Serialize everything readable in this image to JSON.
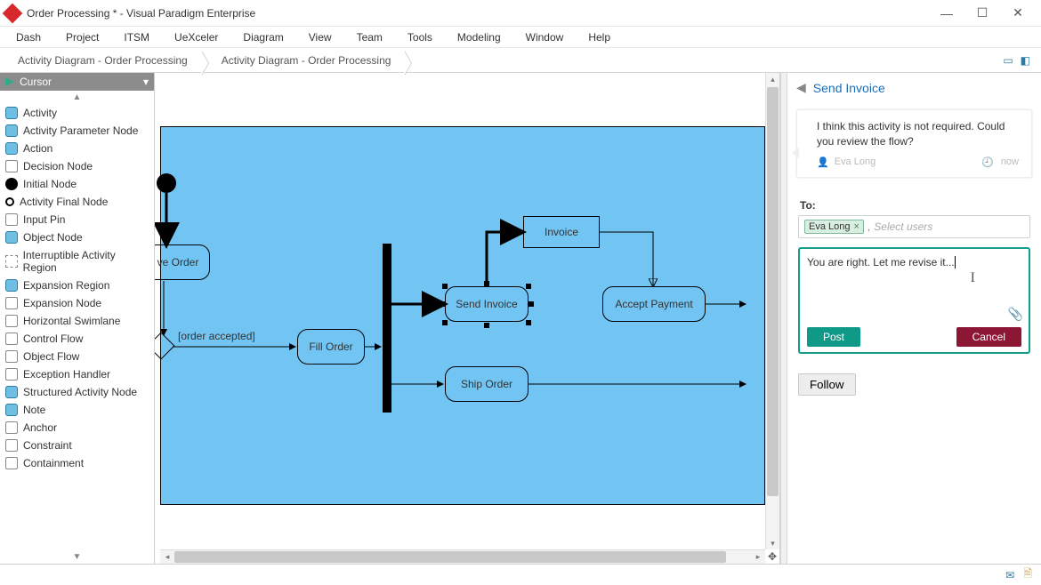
{
  "window": {
    "title": "Order Processing * - Visual Paradigm Enterprise"
  },
  "menu": [
    "Dash",
    "Project",
    "ITSM",
    "UeXceler",
    "Diagram",
    "View",
    "Team",
    "Tools",
    "Modeling",
    "Window",
    "Help"
  ],
  "breadcrumb": [
    "Activity Diagram - Order Processing",
    "Activity Diagram - Order Processing"
  ],
  "palette": {
    "selected": "Cursor",
    "items": [
      "Activity",
      "Activity Parameter Node",
      "Action",
      "Decision Node",
      "Initial Node",
      "Activity Final Node",
      "Input Pin",
      "Object Node",
      "Interruptible Activity Region",
      "Expansion Region",
      "Expansion Node",
      "Horizontal Swimlane",
      "Control Flow",
      "Object Flow",
      "Exception Handler",
      "Structured Activity Node",
      "Note",
      "Anchor",
      "Constraint",
      "Containment"
    ]
  },
  "diagram": {
    "nodes": {
      "ve_order": "ve Order",
      "fill_order": "Fill Order",
      "send_invoice": "Send Invoice",
      "invoice": "Invoice",
      "ship_order": "Ship Order",
      "accept_payment": "Accept Payment"
    },
    "edge_labels": {
      "order_accepted": "[order accepted]"
    }
  },
  "side": {
    "title": "Send Invoice",
    "comment": {
      "text": "I think this activity is not required. Could you review the flow?",
      "user": "Eva Long",
      "time": "now"
    },
    "to_label": "To:",
    "chip": "Eva Long",
    "placeholder": "Select users",
    "message": "You are right. Let me revise it...",
    "post": "Post",
    "cancel": "Cancel",
    "follow": "Follow"
  }
}
